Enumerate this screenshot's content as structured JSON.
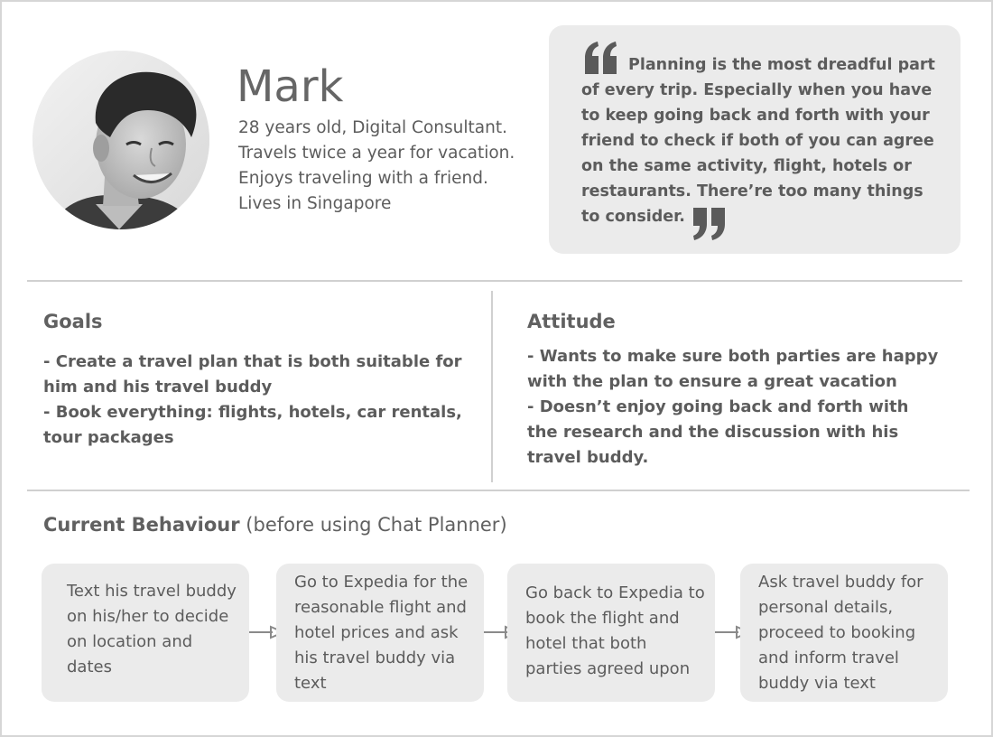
{
  "persona": {
    "name": "Mark",
    "bio": [
      "28 years old, Digital Consultant.",
      "Travels twice a year for vacation.",
      "Enjoys traveling with a friend.",
      "Lives in Singapore"
    ]
  },
  "quote": {
    "text": "Planning is the most dreadful part of every trip. Especially when you have to keep going back and forth with your friend to check if both of you can agree on the same activity, flight, hotels or restaurants. There’re too many things to consider."
  },
  "goals": {
    "title": "Goals",
    "items": [
      "- Create a travel plan that is both suitable for him and his travel buddy",
      "- Book everything: flights, hotels, car rentals, tour packages"
    ]
  },
  "attitude": {
    "title": "Attitude",
    "items": [
      "- Wants to make sure both parties are happy with the plan to ensure a great vacation",
      "- Doesn’t enjoy going back and forth with the research and the discussion with his travel buddy."
    ]
  },
  "behaviour": {
    "title": "Current Behaviour",
    "subtitle": "(before using Chat Planner)",
    "steps": [
      "Text his travel buddy on his/her to decide on location and dates",
      "Go to Expedia for the reasonable flight and hotel prices and ask his travel buddy via text",
      "Go back to Expedia to book the flight and hotel that both parties agreed upon",
      "Ask travel buddy for personal details, proceed to booking and inform travel buddy via text"
    ]
  },
  "colors": {
    "text": "#5c5c5c",
    "card_bg": "#ebebeb",
    "divider": "#d0d0d0"
  }
}
